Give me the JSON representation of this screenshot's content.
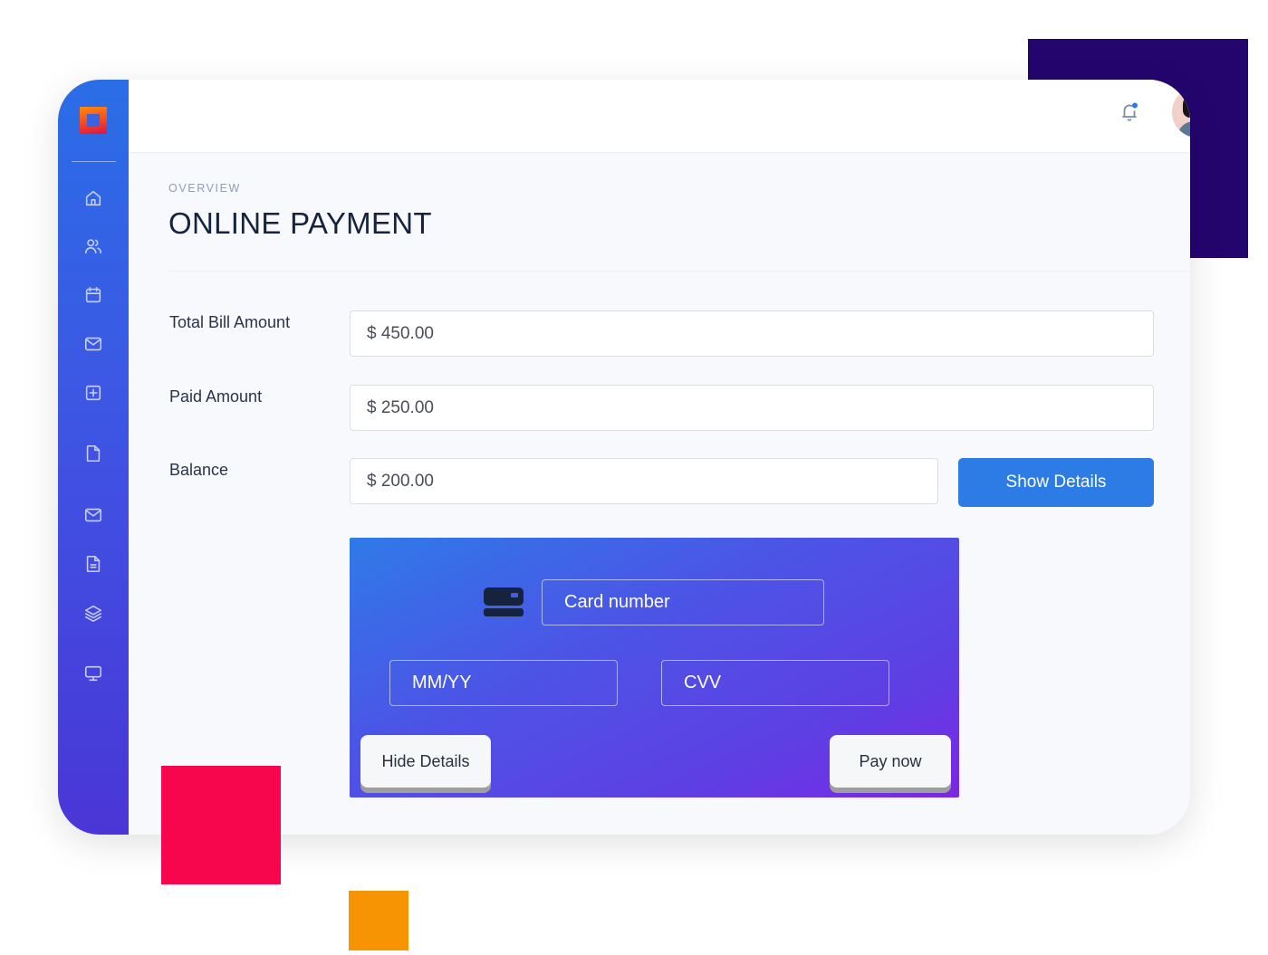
{
  "header": {
    "notification_icon": "bell-icon",
    "notification_badge_color": "#2d7be4",
    "avatar_status": "online",
    "avatar_status_color": "#17d46b"
  },
  "sidebar": {
    "logo": "app-logo",
    "items": [
      {
        "icon": "home-icon"
      },
      {
        "icon": "users-icon"
      },
      {
        "icon": "calendar-icon"
      },
      {
        "icon": "mail-icon"
      },
      {
        "icon": "plus-square-icon"
      },
      {
        "icon": "file-icon"
      },
      {
        "icon": "mail-icon"
      },
      {
        "icon": "document-text-icon"
      },
      {
        "icon": "layers-icon"
      },
      {
        "icon": "monitor-icon"
      }
    ]
  },
  "page": {
    "overline": "OVERVIEW",
    "title": "ONLINE PAYMENT"
  },
  "form": {
    "fields": [
      {
        "label": "Total Bill Amount",
        "value": "$ 450.00"
      },
      {
        "label": "Paid Amount",
        "value": "$ 250.00"
      },
      {
        "label": "Balance",
        "value": "$ 200.00"
      }
    ],
    "show_details_label": "Show Details"
  },
  "card": {
    "icon": "credit-card-icon",
    "card_number_placeholder": "Card number",
    "expiry_placeholder": "MM/YY",
    "cvv_placeholder": "CVV",
    "hide_details_label": "Hide Details",
    "pay_now_label": "Pay now"
  },
  "colors": {
    "primary": "#2d7be4",
    "deco_purple": "#24056e",
    "deco_red": "#f7064e",
    "deco_orange": "#f79404"
  }
}
